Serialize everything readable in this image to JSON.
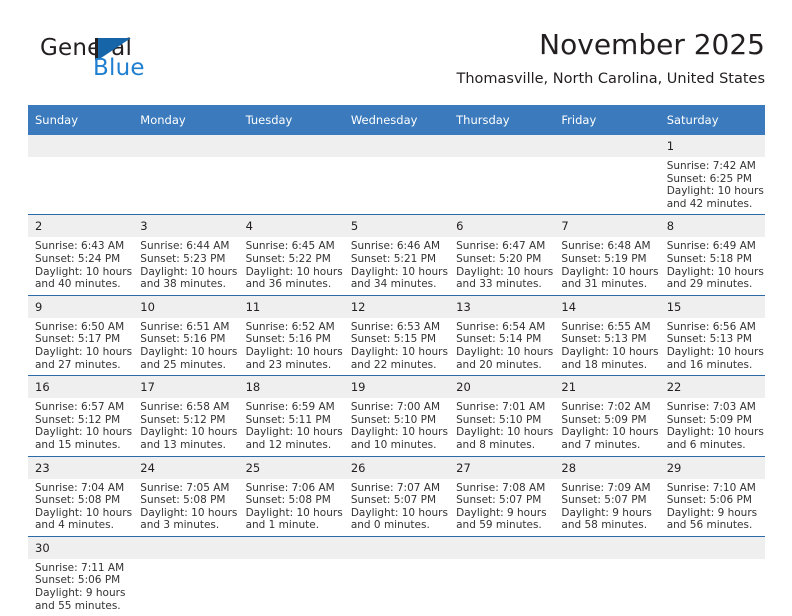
{
  "brand": {
    "name_part1": "General",
    "name_part2": "Blue",
    "flag_icon": "flag-triangle-icon",
    "accent_color": "#1f7fd0"
  },
  "header": {
    "title": "November 2025",
    "subtitle": "Thomasville, North Carolina, United States"
  },
  "colors": {
    "header_blue": "#3a7abd",
    "row_divider": "#2d6aa8",
    "daynum_band": "#efefef",
    "text": "#231f20"
  },
  "calendar": {
    "weekday_headers": [
      "Sunday",
      "Monday",
      "Tuesday",
      "Wednesday",
      "Thursday",
      "Friday",
      "Saturday"
    ],
    "weeks": [
      [
        {
          "day": "",
          "lines": []
        },
        {
          "day": "",
          "lines": []
        },
        {
          "day": "",
          "lines": []
        },
        {
          "day": "",
          "lines": []
        },
        {
          "day": "",
          "lines": []
        },
        {
          "day": "",
          "lines": []
        },
        {
          "day": "1",
          "lines": [
            "Sunrise: 7:42 AM",
            "Sunset: 6:25 PM",
            "Daylight: 10 hours",
            "and 42 minutes."
          ]
        }
      ],
      [
        {
          "day": "2",
          "lines": [
            "Sunrise: 6:43 AM",
            "Sunset: 5:24 PM",
            "Daylight: 10 hours",
            "and 40 minutes."
          ]
        },
        {
          "day": "3",
          "lines": [
            "Sunrise: 6:44 AM",
            "Sunset: 5:23 PM",
            "Daylight: 10 hours",
            "and 38 minutes."
          ]
        },
        {
          "day": "4",
          "lines": [
            "Sunrise: 6:45 AM",
            "Sunset: 5:22 PM",
            "Daylight: 10 hours",
            "and 36 minutes."
          ]
        },
        {
          "day": "5",
          "lines": [
            "Sunrise: 6:46 AM",
            "Sunset: 5:21 PM",
            "Daylight: 10 hours",
            "and 34 minutes."
          ]
        },
        {
          "day": "6",
          "lines": [
            "Sunrise: 6:47 AM",
            "Sunset: 5:20 PM",
            "Daylight: 10 hours",
            "and 33 minutes."
          ]
        },
        {
          "day": "7",
          "lines": [
            "Sunrise: 6:48 AM",
            "Sunset: 5:19 PM",
            "Daylight: 10 hours",
            "and 31 minutes."
          ]
        },
        {
          "day": "8",
          "lines": [
            "Sunrise: 6:49 AM",
            "Sunset: 5:18 PM",
            "Daylight: 10 hours",
            "and 29 minutes."
          ]
        }
      ],
      [
        {
          "day": "9",
          "lines": [
            "Sunrise: 6:50 AM",
            "Sunset: 5:17 PM",
            "Daylight: 10 hours",
            "and 27 minutes."
          ]
        },
        {
          "day": "10",
          "lines": [
            "Sunrise: 6:51 AM",
            "Sunset: 5:16 PM",
            "Daylight: 10 hours",
            "and 25 minutes."
          ]
        },
        {
          "day": "11",
          "lines": [
            "Sunrise: 6:52 AM",
            "Sunset: 5:16 PM",
            "Daylight: 10 hours",
            "and 23 minutes."
          ]
        },
        {
          "day": "12",
          "lines": [
            "Sunrise: 6:53 AM",
            "Sunset: 5:15 PM",
            "Daylight: 10 hours",
            "and 22 minutes."
          ]
        },
        {
          "day": "13",
          "lines": [
            "Sunrise: 6:54 AM",
            "Sunset: 5:14 PM",
            "Daylight: 10 hours",
            "and 20 minutes."
          ]
        },
        {
          "day": "14",
          "lines": [
            "Sunrise: 6:55 AM",
            "Sunset: 5:13 PM",
            "Daylight: 10 hours",
            "and 18 minutes."
          ]
        },
        {
          "day": "15",
          "lines": [
            "Sunrise: 6:56 AM",
            "Sunset: 5:13 PM",
            "Daylight: 10 hours",
            "and 16 minutes."
          ]
        }
      ],
      [
        {
          "day": "16",
          "lines": [
            "Sunrise: 6:57 AM",
            "Sunset: 5:12 PM",
            "Daylight: 10 hours",
            "and 15 minutes."
          ]
        },
        {
          "day": "17",
          "lines": [
            "Sunrise: 6:58 AM",
            "Sunset: 5:12 PM",
            "Daylight: 10 hours",
            "and 13 minutes."
          ]
        },
        {
          "day": "18",
          "lines": [
            "Sunrise: 6:59 AM",
            "Sunset: 5:11 PM",
            "Daylight: 10 hours",
            "and 12 minutes."
          ]
        },
        {
          "day": "19",
          "lines": [
            "Sunrise: 7:00 AM",
            "Sunset: 5:10 PM",
            "Daylight: 10 hours",
            "and 10 minutes."
          ]
        },
        {
          "day": "20",
          "lines": [
            "Sunrise: 7:01 AM",
            "Sunset: 5:10 PM",
            "Daylight: 10 hours",
            "and 8 minutes."
          ]
        },
        {
          "day": "21",
          "lines": [
            "Sunrise: 7:02 AM",
            "Sunset: 5:09 PM",
            "Daylight: 10 hours",
            "and 7 minutes."
          ]
        },
        {
          "day": "22",
          "lines": [
            "Sunrise: 7:03 AM",
            "Sunset: 5:09 PM",
            "Daylight: 10 hours",
            "and 6 minutes."
          ]
        }
      ],
      [
        {
          "day": "23",
          "lines": [
            "Sunrise: 7:04 AM",
            "Sunset: 5:08 PM",
            "Daylight: 10 hours",
            "and 4 minutes."
          ]
        },
        {
          "day": "24",
          "lines": [
            "Sunrise: 7:05 AM",
            "Sunset: 5:08 PM",
            "Daylight: 10 hours",
            "and 3 minutes."
          ]
        },
        {
          "day": "25",
          "lines": [
            "Sunrise: 7:06 AM",
            "Sunset: 5:08 PM",
            "Daylight: 10 hours",
            "and 1 minute."
          ]
        },
        {
          "day": "26",
          "lines": [
            "Sunrise: 7:07 AM",
            "Sunset: 5:07 PM",
            "Daylight: 10 hours",
            "and 0 minutes."
          ]
        },
        {
          "day": "27",
          "lines": [
            "Sunrise: 7:08 AM",
            "Sunset: 5:07 PM",
            "Daylight: 9 hours",
            "and 59 minutes."
          ]
        },
        {
          "day": "28",
          "lines": [
            "Sunrise: 7:09 AM",
            "Sunset: 5:07 PM",
            "Daylight: 9 hours",
            "and 58 minutes."
          ]
        },
        {
          "day": "29",
          "lines": [
            "Sunrise: 7:10 AM",
            "Sunset: 5:06 PM",
            "Daylight: 9 hours",
            "and 56 minutes."
          ]
        }
      ],
      [
        {
          "day": "30",
          "lines": [
            "Sunrise: 7:11 AM",
            "Sunset: 5:06 PM",
            "Daylight: 9 hours",
            "and 55 minutes."
          ]
        },
        {
          "day": "",
          "lines": []
        },
        {
          "day": "",
          "lines": []
        },
        {
          "day": "",
          "lines": []
        },
        {
          "day": "",
          "lines": []
        },
        {
          "day": "",
          "lines": []
        },
        {
          "day": "",
          "lines": []
        }
      ]
    ]
  }
}
